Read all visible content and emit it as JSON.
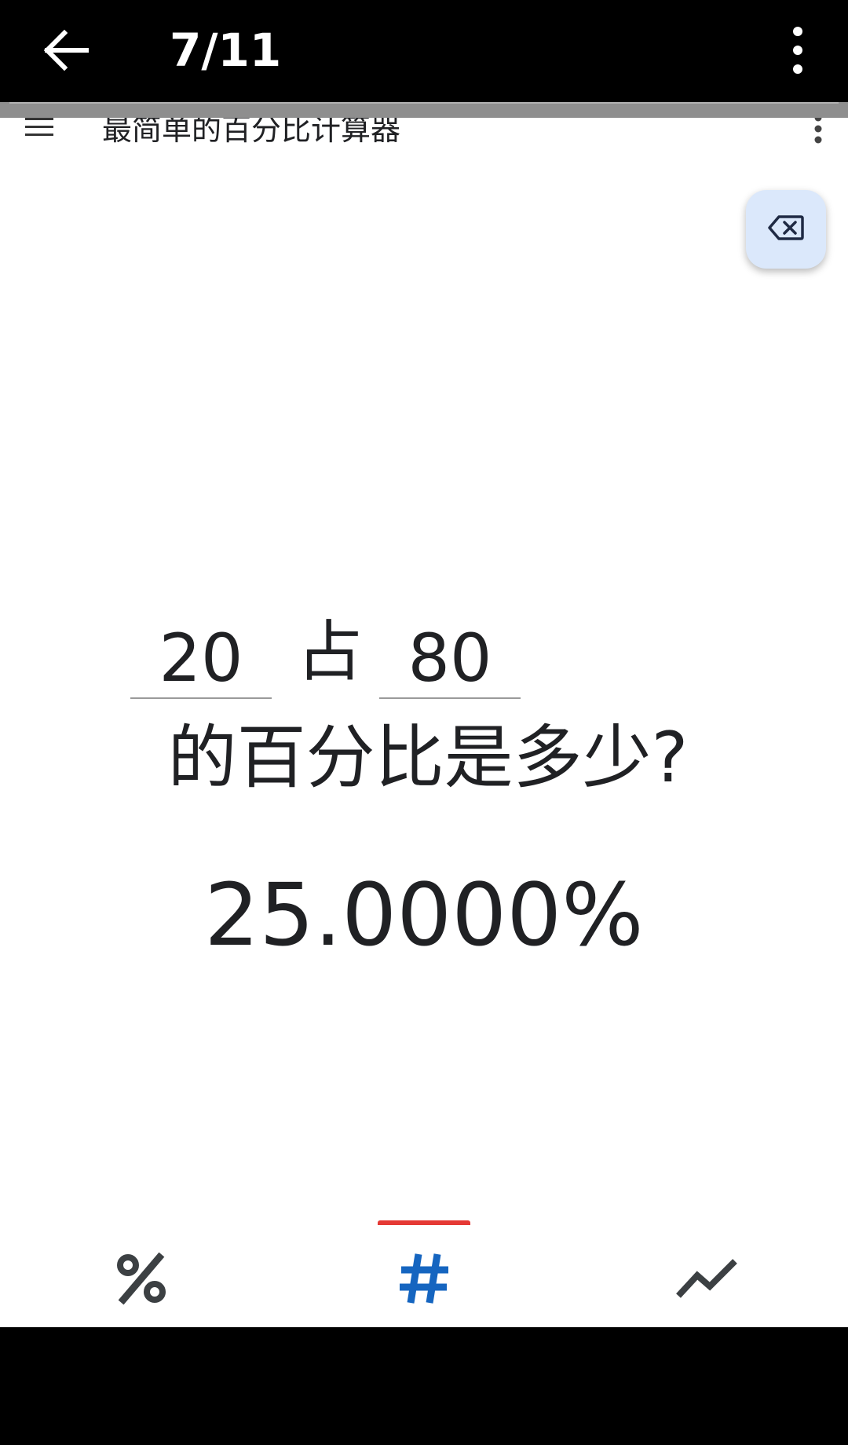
{
  "viewer": {
    "counter": "7/11",
    "back_icon": "arrow-left-icon",
    "more_icon": "more-vert-icon"
  },
  "app": {
    "title": "最简单的百分比计算器",
    "menu_icon": "menu-icon",
    "overflow_icon": "more-vert-icon",
    "backspace_icon": "backspace-icon"
  },
  "calculator": {
    "value_a": "20",
    "connector": "占",
    "value_b": "80",
    "question": "的百分比是多少?",
    "result": "25.0000%"
  },
  "bottom_nav": {
    "tabs": [
      {
        "icon": "percent-icon",
        "selected": false
      },
      {
        "icon": "hash-icon",
        "selected": true
      },
      {
        "icon": "trending-icon",
        "selected": false
      }
    ]
  },
  "colors": {
    "accent_blue": "#1565c0",
    "indicator_red": "#e53935",
    "fab_bg": "#dbe8fb",
    "text": "#202124"
  }
}
